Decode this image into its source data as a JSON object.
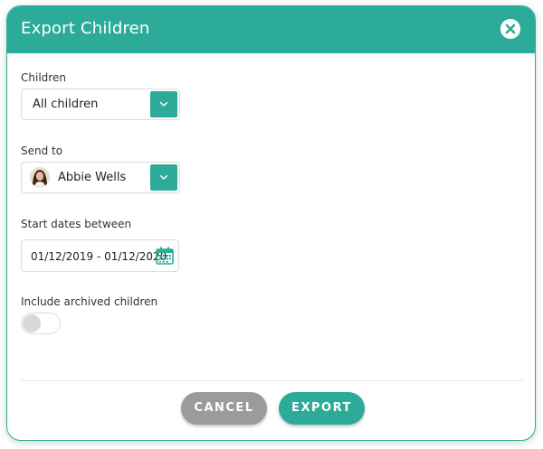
{
  "dialog": {
    "title": "Export Children",
    "close_icon": "close-circle-icon"
  },
  "fields": {
    "children": {
      "label": "Children",
      "value": "All children",
      "caret_icon": "chevron-down-icon"
    },
    "send_to": {
      "label": "Send to",
      "value": "Abbie Wells",
      "avatar_icon": "user-avatar",
      "caret_icon": "chevron-down-icon"
    },
    "start_dates": {
      "label": "Start dates between",
      "value": "01/12/2019 - 01/12/2020",
      "icon": "calendar-icon"
    },
    "include_archived": {
      "label": "Include archived children",
      "checked": false
    }
  },
  "actions": {
    "cancel_label": "CANCEL",
    "export_label": "EXPORT"
  },
  "colors": {
    "accent": "#2bab98",
    "cancel": "#9b9b9b",
    "header_text": "#ffffff"
  }
}
